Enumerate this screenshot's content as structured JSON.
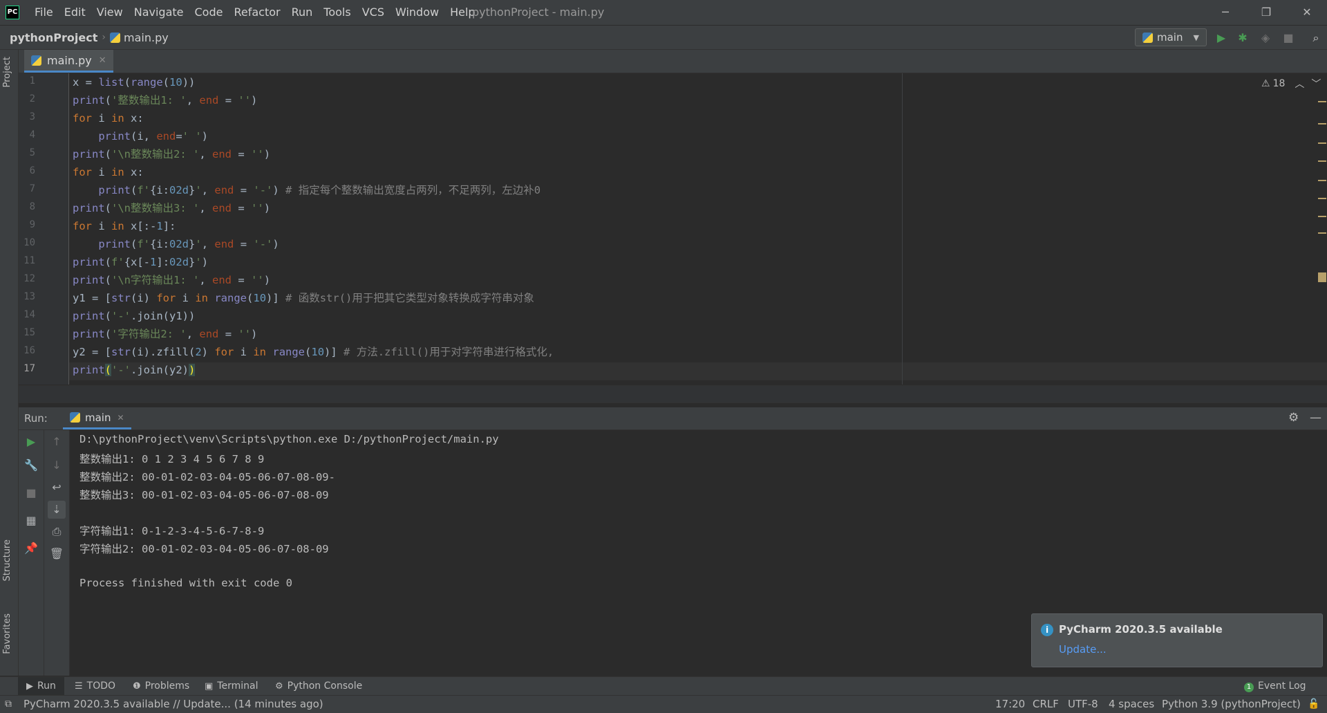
{
  "app": {
    "logo_text": "PC",
    "window_title": "pythonProject - main.py",
    "menu": [
      "File",
      "Edit",
      "View",
      "Navigate",
      "Code",
      "Refactor",
      "Run",
      "Tools",
      "VCS",
      "Window",
      "Help"
    ],
    "window_controls": {
      "minimize": "─",
      "restore": "❐",
      "close": "✕"
    }
  },
  "navbar": {
    "project": "pythonProject",
    "separator": "›",
    "file": "main.py",
    "run_config": "main"
  },
  "left_strip": {
    "project": "Project",
    "structure": "Structure",
    "favorites": "Favorites"
  },
  "editor": {
    "tab": "main.py",
    "warnings": "18",
    "line_numbers": [
      "1",
      "2",
      "3",
      "4",
      "5",
      "6",
      "7",
      "8",
      "9",
      "10",
      "11",
      "12",
      "13",
      "14",
      "15",
      "16",
      "17"
    ]
  },
  "run_panel": {
    "label": "Run:",
    "tab": "main",
    "console": [
      "D:\\pythonProject\\venv\\Scripts\\python.exe D:/pythonProject/main.py",
      "整数输出1: 0 1 2 3 4 5 6 7 8 9",
      "整数输出2: 00-01-02-03-04-05-06-07-08-09-",
      "整数输出3: 00-01-02-03-04-05-06-07-08-09",
      "",
      "字符输出1: 0-1-2-3-4-5-6-7-8-9",
      "字符输出2: 00-01-02-03-04-05-06-07-08-09",
      "",
      "Process finished with exit code 0"
    ]
  },
  "notification": {
    "title": "PyCharm 2020.3.5 available",
    "link": "Update..."
  },
  "bottom_bar": {
    "run": "Run",
    "todo": "TODO",
    "problems": "Problems",
    "terminal": "Terminal",
    "python_console": "Python Console",
    "event_log": "Event Log",
    "event_log_count": "1"
  },
  "status_bar": {
    "message": "PyCharm 2020.3.5 available // Update... (14 minutes ago)",
    "position": "17:20",
    "line_sep": "CRLF",
    "encoding": "UTF-8",
    "indent": "4 spaces",
    "interpreter": "Python 3.9 (pythonProject)"
  },
  "colors": {
    "accent": "#4a88c7",
    "keyword": "#cc7832",
    "string": "#6a8759",
    "number": "#6897bb",
    "run_green": "#499c54"
  }
}
